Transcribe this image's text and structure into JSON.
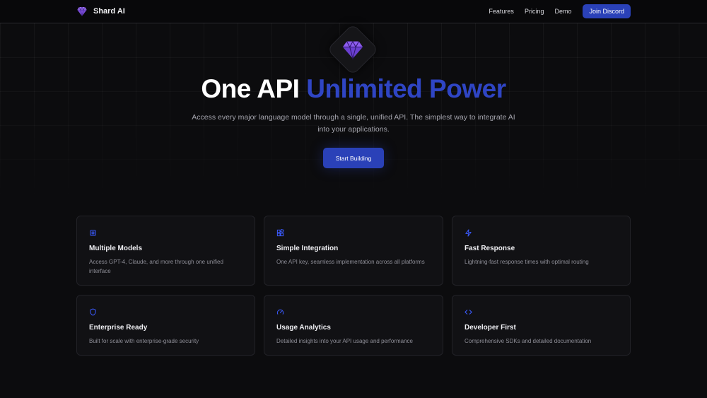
{
  "nav": {
    "brand": "Shard AI",
    "links": [
      "Features",
      "Pricing",
      "Demo"
    ],
    "cta": "Join Discord"
  },
  "hero": {
    "title_main": "One API",
    "title_accent": "Unlimited Power",
    "subtitle": "Access every major language model through a single, unified API. The simplest way to integrate AI into your applications.",
    "cta": "Start Building"
  },
  "features": [
    {
      "icon": "cpu-icon",
      "title": "Multiple Models",
      "description": "Access GPT-4, Claude, and more through one unified interface"
    },
    {
      "icon": "blocks-icon",
      "title": "Simple Integration",
      "description": "One API key, seamless implementation across all platforms"
    },
    {
      "icon": "zap-icon",
      "title": "Fast Response",
      "description": "Lightning-fast response times with optimal routing"
    },
    {
      "icon": "shield-icon",
      "title": "Enterprise Ready",
      "description": "Built for scale with enterprise-grade security"
    },
    {
      "icon": "gauge-icon",
      "title": "Usage Analytics",
      "description": "Detailed insights into your API usage and performance"
    },
    {
      "icon": "code-icon",
      "title": "Developer First",
      "description": "Comprehensive SDKs and detailed documentation"
    }
  ],
  "colors": {
    "accent": "#2a41b8",
    "title_accent": "#2f45c4",
    "gem": "#7c4ddb",
    "background": "#0c0c0e",
    "card": "#111114"
  }
}
